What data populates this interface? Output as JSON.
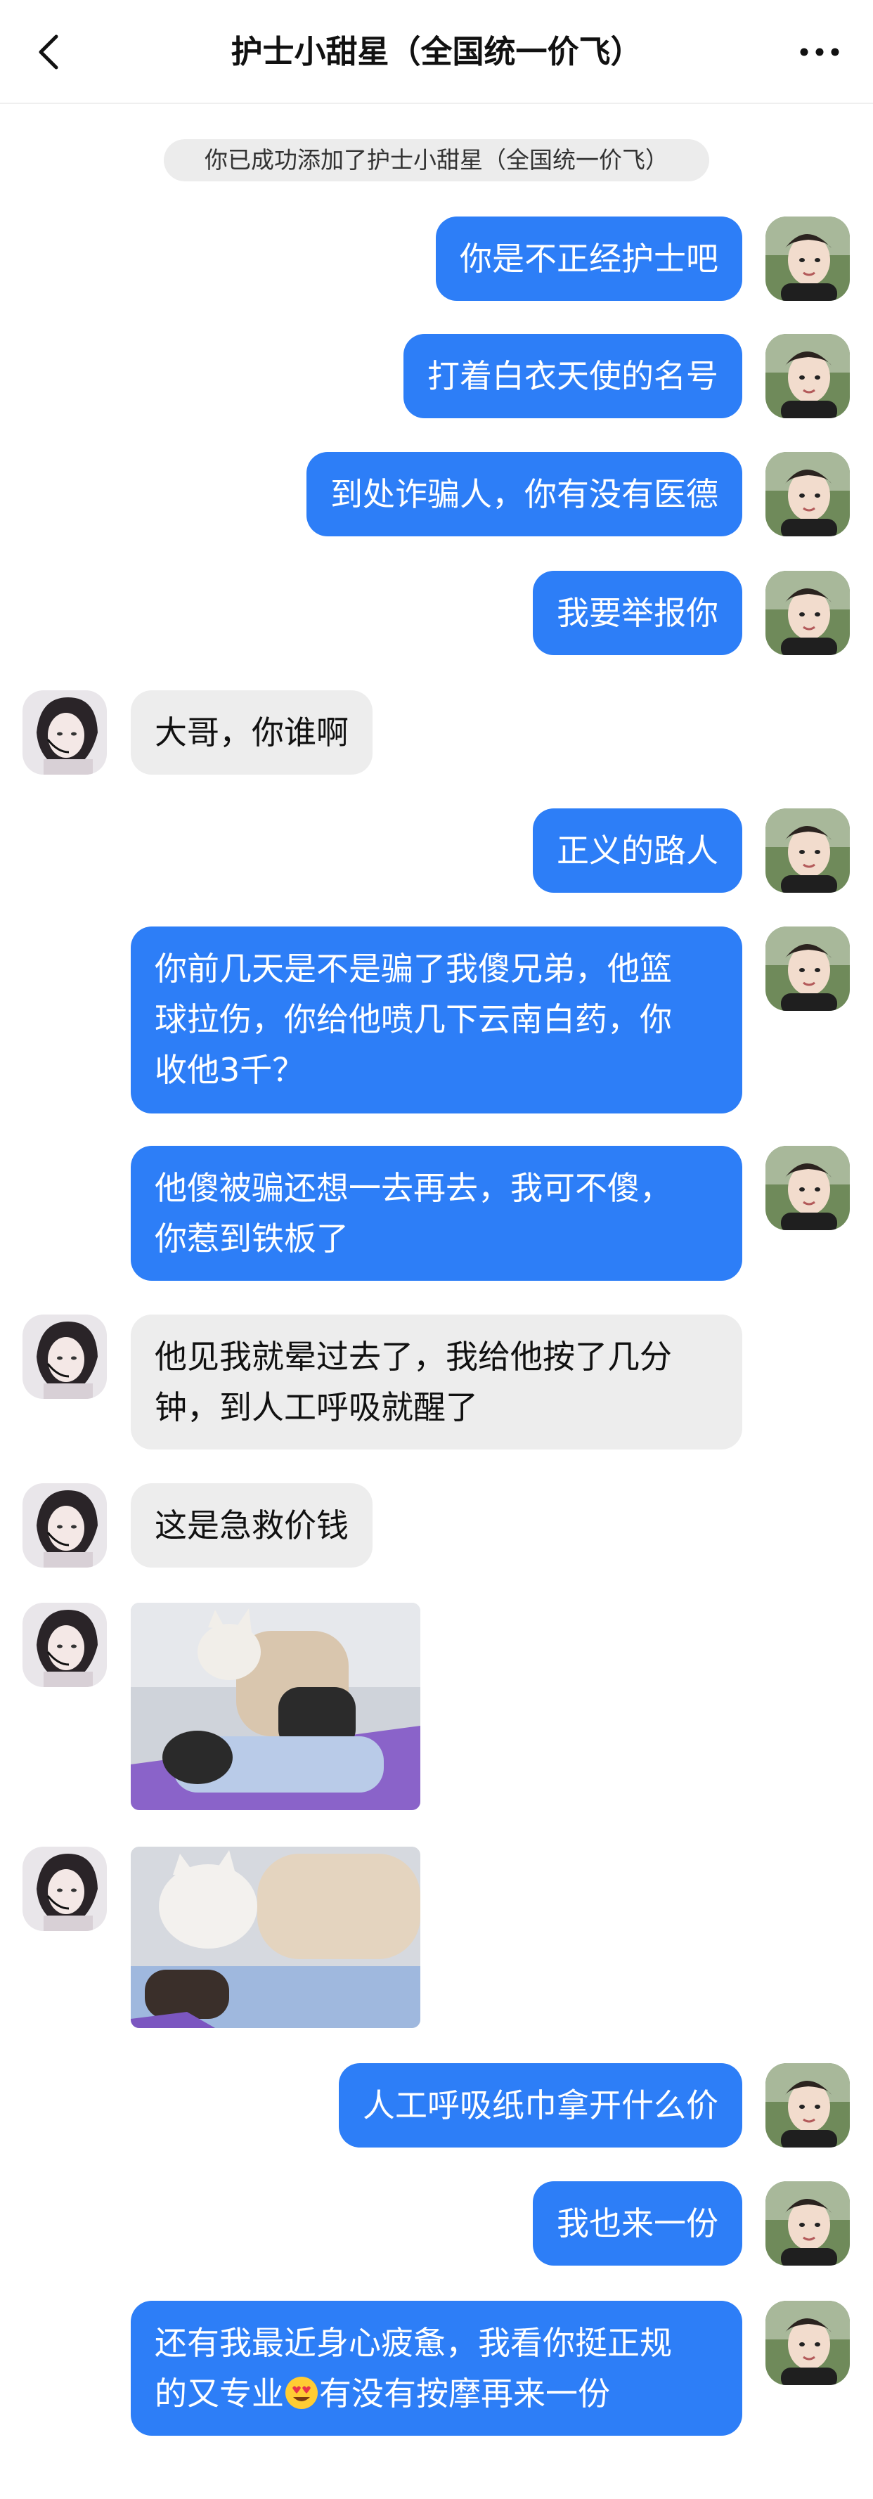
{
  "header": {
    "title": "护士小甜星（全国统一价飞）",
    "back_icon": "chevron-left-icon",
    "more_icon": "more-horizontal-icon"
  },
  "system_note": "你已成功添加了护士小甜星（全国统一价飞）",
  "colors": {
    "my_bubble": "#2d7ef7",
    "their_bubble": "#ededed"
  },
  "messages": [
    {
      "from": "me",
      "lines": [
        "你是不正经护士吧"
      ]
    },
    {
      "from": "me",
      "lines": [
        "打着白衣天使的名号"
      ]
    },
    {
      "from": "me",
      "lines": [
        "到处诈骗人，你有没有医德"
      ]
    },
    {
      "from": "me",
      "lines": [
        "我要举报你"
      ]
    },
    {
      "from": "them",
      "lines": [
        "大哥，你谁啊"
      ]
    },
    {
      "from": "me",
      "lines": [
        "正义的路人"
      ]
    },
    {
      "from": "me",
      "lines": [
        "你前几天是不是骗了我傻兄弟，他篮",
        "球拉伤，你给他喷几下云南白药，你",
        "收他3千？"
      ]
    },
    {
      "from": "me",
      "lines": [
        "他傻被骗还想一去再去，我可不傻，",
        "你惹到铁板了"
      ]
    },
    {
      "from": "them",
      "lines": [
        "他见我就晕过去了，我给他按了几分",
        "钟，到人工呼吸就醒了"
      ]
    },
    {
      "from": "them",
      "lines": [
        "这是急救价钱"
      ]
    },
    {
      "from": "them",
      "type": "image"
    },
    {
      "from": "them",
      "type": "image"
    },
    {
      "from": "me",
      "lines": [
        "人工呼吸纸巾拿开什么价"
      ]
    },
    {
      "from": "me",
      "lines": [
        "我也来一份"
      ]
    },
    {
      "from": "me",
      "lines": [
        "还有我最近身心疲惫，我看你挺正规",
        "的又专业",
        "有没有按摩再来一份"
      ],
      "emoji": "smiling-face-with-heart-eyes"
    }
  ]
}
